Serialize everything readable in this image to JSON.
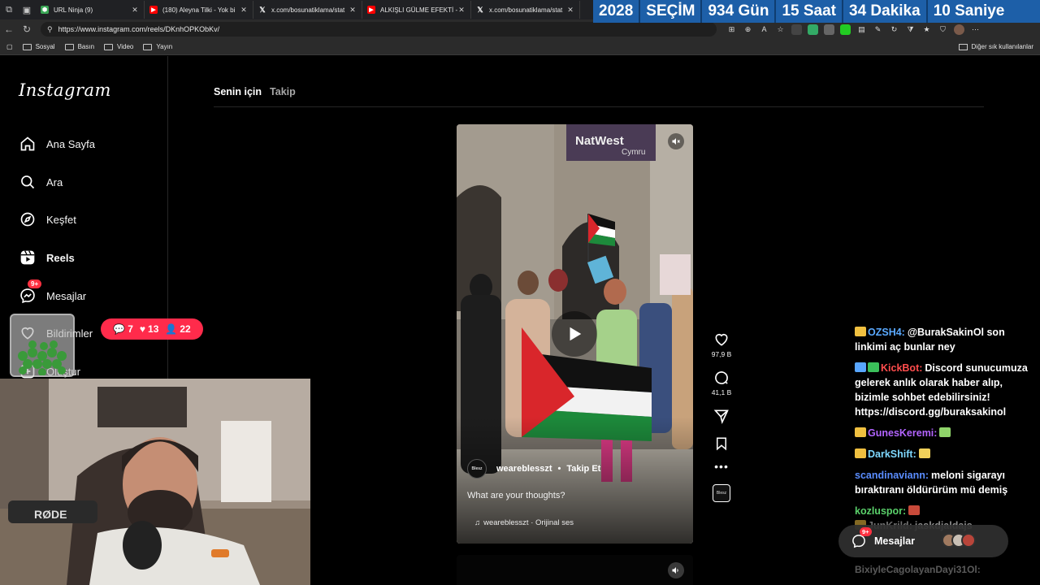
{
  "browser": {
    "tabs": [
      {
        "title": "URL Ninja (9)",
        "favicon": "ninja"
      },
      {
        "title": "(180) Aleyna Tilki - Yok bi",
        "favicon": "youtube"
      },
      {
        "title": "x.com/bosunatiklama/stat",
        "favicon": "x"
      },
      {
        "title": "ALKIŞLI GÜLME EFEKTİ - Yo",
        "favicon": "youtube"
      },
      {
        "title": "x.com/bosunatiklama/stat",
        "favicon": "x"
      }
    ],
    "url": "https://www.instagram.com/reels/DKnhOPKObKv/",
    "bookmarks": [
      "Sosyal",
      "Basın",
      "Video",
      "Yayın"
    ],
    "other_bookmarks": "Diğer sık kullanılanlar"
  },
  "countdown": {
    "year": "2028",
    "label": "SEÇİM",
    "days": "934 Gün",
    "hours": "15 Saat",
    "minutes": "34 Dakika",
    "seconds": "10 Saniye",
    "color": "#1d5fa8"
  },
  "instagram": {
    "logo": "Instagram",
    "nav": [
      {
        "label": "Ana Sayfa",
        "icon": "home-icon"
      },
      {
        "label": "Ara",
        "icon": "search-icon"
      },
      {
        "label": "Keşfet",
        "icon": "compass-icon"
      },
      {
        "label": "Reels",
        "icon": "reels-icon"
      },
      {
        "label": "Mesajlar",
        "icon": "messenger-icon",
        "badge": "9+"
      },
      {
        "label": "Bildirimler",
        "icon": "heart-icon"
      },
      {
        "label": "Oluştur",
        "icon": "plus-icon"
      }
    ],
    "feed_tabs": [
      "Senin için",
      "Takip"
    ],
    "reel": {
      "author": "weareblesszt",
      "follow": "Takip Et",
      "caption": "What are your thoughts?",
      "audio": "weareblesszt · Orijinal ses",
      "sign_text": "NatWest Cymru"
    },
    "actions": {
      "likes": "97,9 B",
      "comments": "41,1 B"
    },
    "messages_bar": {
      "label": "Mesajlar",
      "badge": "9+"
    }
  },
  "stream": {
    "stats": {
      "comments": "7",
      "likes": "13",
      "viewers": "22"
    },
    "chat": [
      {
        "user": "OZSH4:",
        "color": "#5aa9ff",
        "text": "@BurakSakinOl son linkimi aç bunlar ney"
      },
      {
        "user": "KickBot:",
        "color": "#ff4d4d",
        "text": "Discord sunucumuza gelerek anlık olarak haber alıp, bizimle sohbet edebilirsiniz! https://discord.gg/buraksakinol"
      },
      {
        "user": "GunesKeremi:",
        "color": "#b264ff",
        "text": ""
      },
      {
        "user": "DarkShift:",
        "color": "#7fd8ff",
        "text": ""
      },
      {
        "user": "scandinaviann:",
        "color": "#5a8dff",
        "text": "meloni sigarayı bıraktıranı öldürürüm mü demiş"
      },
      {
        "user": "kozluspor:",
        "color": "#5ad06a",
        "text": ""
      },
      {
        "user": "JunKrild:",
        "color": "#c8c8c8",
        "text": "jaskdjaldajs"
      }
    ],
    "faded_line": "BixiyleCagolayanDayi31Ol:"
  }
}
